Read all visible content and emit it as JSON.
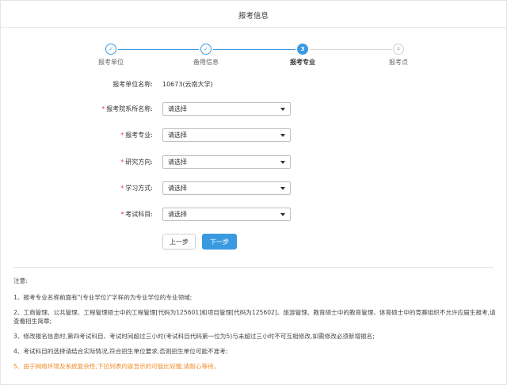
{
  "header": {
    "title": "报考信息"
  },
  "steps": [
    {
      "index": "1",
      "label": "报考单位",
      "state": "done"
    },
    {
      "index": "2",
      "label": "备用信息",
      "state": "done"
    },
    {
      "index": "3",
      "label": "报考专业",
      "state": "active"
    },
    {
      "index": "4",
      "label": "报考点",
      "state": "todo"
    }
  ],
  "form": {
    "unit_label": "报考单位名称:",
    "unit_value": "10673(云南大学)",
    "department_label": "报考院系所名称:",
    "department_value": "请选择",
    "major_label": "报考专业:",
    "major_value": "请选择",
    "direction_label": "研究方向:",
    "direction_value": "请选择",
    "study_mode_label": "学习方式:",
    "study_mode_value": "请选择",
    "subject_label": "考试科目:",
    "subject_value": "请选择",
    "required_mark": "*"
  },
  "buttons": {
    "prev_label": "上一步",
    "next_label": "下一步"
  },
  "notes": {
    "title": "注意:",
    "items": [
      "1、报考专业名称前面有\"(专业学位)\"字样的为专业学位的专业领域;",
      "2、工商管理、公共管理、工程管理硕士中的工程管理[代码为125601]和项目管理[代码为125602]、旅游管理、教育硕士中的教育管理、体育硕士中的竞赛组织不允许应届生报考,请查看招生简章;",
      "3、修改报名信息时,第四考试科目、考试时间超过三小时(考试科目代码第一位为5)与未超过三小时不可互相修改,如需修改必须新增报名;",
      "4、考试科目的选择请结合实际情况,符合招生单位要求,否则招生单位可能不准考;",
      "5、由于网络环境及系统复杂性,下拉列表内容显示的可能比较慢,请耐心等待。"
    ]
  },
  "colors": {
    "accent": "#3a9ae0",
    "warning": "#f08a24",
    "required": "#e03b3b"
  },
  "icons": {
    "done": "check-icon",
    "select": "chevron-down-icon"
  }
}
